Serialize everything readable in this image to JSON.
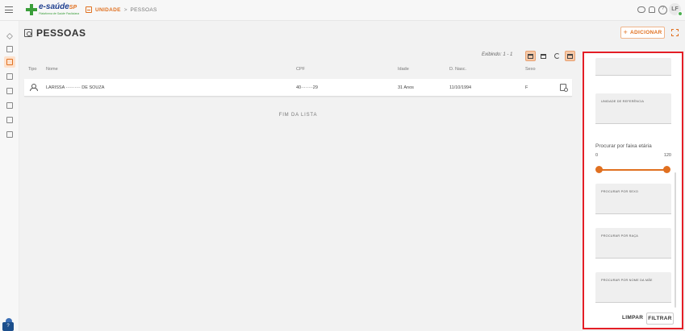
{
  "header": {
    "logo_text": "e-saúde",
    "logo_sp": "SP",
    "logo_tagline": "Plataforma de Saúde Paulistana",
    "breadcrumb_section": "UNIDADE",
    "breadcrumb_sep": ">",
    "breadcrumb_current": "PESSOAS",
    "avatar_initials": "LF"
  },
  "page": {
    "title": "PESSOAS",
    "add_label": "ADICIONAR",
    "add_plus": "+",
    "showing": "Exibindo: 1 - 1",
    "end_of_list": "FIM DA LISTA"
  },
  "table": {
    "columns": [
      "Tipo",
      "Nome",
      "CPF",
      "Idade",
      "D. Nasc.",
      "Sexo"
    ],
    "rows": [
      {
        "nome": "LARISSA ·········· DE SOUZA",
        "cpf": "40········29",
        "idade": "31 Anos",
        "nasc": "11/10/1994",
        "sexo": "F"
      }
    ]
  },
  "filters": {
    "unidade_referencia": "UNIDADE DE REFERÊNCIA",
    "faixa_etaria_title": "Procurar por faixa etária",
    "faixa_min": "0",
    "faixa_max": "120",
    "faixa_range": [
      0,
      120
    ],
    "sexo": "PROCURAR POR SEXO",
    "raca": "PROCURAR POR RAÇA",
    "nome_mae": "PROCURAR POR NOME DA MÃE",
    "limpar": "LIMPAR",
    "filtrar": "FILTRAR"
  },
  "colors": {
    "accent": "#e07020",
    "highlight_border": "#e41e26",
    "brand_blue": "#1f3f8f",
    "brand_green": "#3a9e3a"
  }
}
